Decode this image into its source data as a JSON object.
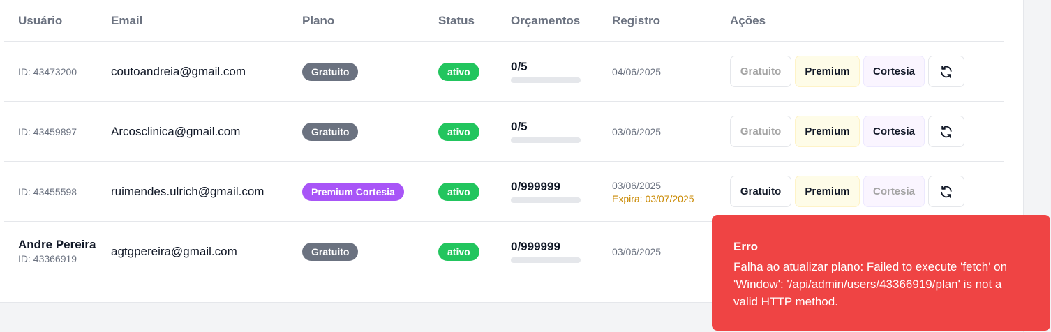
{
  "table": {
    "headers": {
      "user": "Usuário",
      "email": "Email",
      "plan": "Plano",
      "status": "Status",
      "budgets": "Orçamentos",
      "registered": "Registro",
      "actions": "Ações"
    },
    "rows": [
      {
        "name": "",
        "id": "ID: 43473200",
        "email": "coutoandreia@gmail.com",
        "plan_badge": "Gratuito",
        "status": "ativo",
        "budget": "0/5",
        "budget_fraction": 0,
        "registered": "04/06/2025",
        "expires": ""
      },
      {
        "name": "",
        "id": "ID: 43459897",
        "email": "Arcosclinica@gmail.com",
        "plan_badge": "Gratuito",
        "status": "ativo",
        "budget": "0/5",
        "budget_fraction": 0,
        "registered": "03/06/2025",
        "expires": ""
      },
      {
        "name": "",
        "id": "ID: 43455598",
        "email": "ruimendes.ulrich@gmail.com",
        "plan_badge": "Premium Cortesia",
        "status": "ativo",
        "budget": "0/999999",
        "budget_fraction": 0,
        "registered": "03/06/2025",
        "expires": "Expira: 03/07/2025"
      },
      {
        "name": "Andre Pereira",
        "id": "ID: 43366919",
        "email": "agtgpereira@gmail.com",
        "plan_badge": "Gratuito",
        "status": "ativo",
        "budget": "0/999999",
        "budget_fraction": 0,
        "registered": "03/06/2025",
        "expires": ""
      }
    ],
    "action_labels": {
      "free": "Gratuito",
      "premium": "Premium",
      "courtesy": "Cortesia",
      "refresh_icon": "refresh-icon"
    }
  },
  "toast": {
    "title": "Erro",
    "message": "Falha ao atualizar plano: Failed to execute 'fetch' on 'Window': '/api/admin/users/43366919/plan' is not a valid HTTP method."
  },
  "colors": {
    "badge_free": "#6b7280",
    "badge_courtesy": "#a855f7",
    "status_active": "#22c55e",
    "toast_bg": "#ef4444",
    "expires_text": "#ca8a04"
  }
}
